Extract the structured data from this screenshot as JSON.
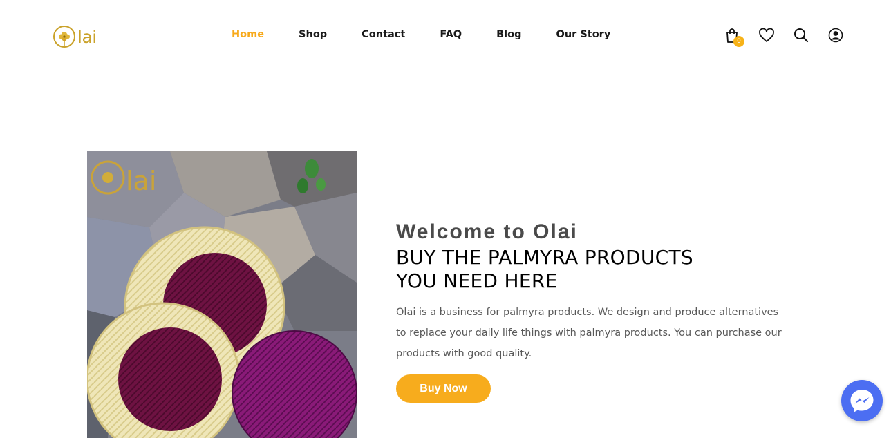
{
  "brand": {
    "logo_text": "lai",
    "accent_color": "#f7a91a",
    "logo_color": "#caa22a"
  },
  "nav": {
    "items": [
      {
        "label": "Home",
        "active": true
      },
      {
        "label": "Shop",
        "active": false
      },
      {
        "label": "Contact",
        "active": false
      },
      {
        "label": "FAQ",
        "active": false
      },
      {
        "label": "Blog",
        "active": false
      },
      {
        "label": "Our Story",
        "active": false
      }
    ]
  },
  "header_icons": {
    "cart_icon": "shopping-bag-icon",
    "cart_count": "0",
    "wishlist_icon": "heart-icon",
    "search_icon": "search-icon",
    "account_icon": "user-account-icon"
  },
  "hero": {
    "image_subject": "woven palmyra coasters on rocks",
    "image_logo_text": "lai",
    "welcome": "Welcome to Olai",
    "headline_line1": "BUY THE PALMYRA PRODUCTS",
    "headline_line2": "YOU NEED HERE",
    "description": "Olai is a business for palmyra products. We design and produce alternatives to replace your daily life things with palmyra products. You can purchase our products with good quality.",
    "button_label": "Buy Now",
    "button_color": "#f7ac1d"
  },
  "chat_widget": {
    "icon": "messenger-icon",
    "color": "#4c6ef2"
  }
}
